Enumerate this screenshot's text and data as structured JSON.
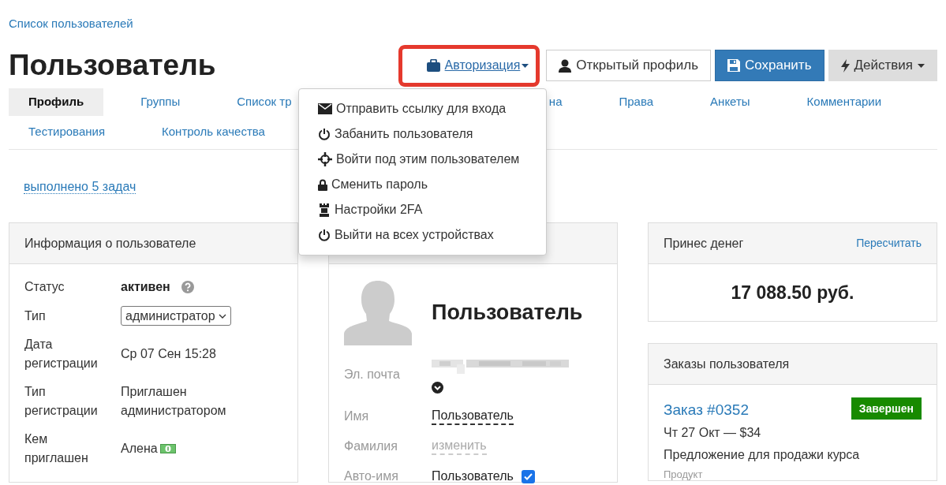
{
  "breadcrumb": "Список пользователей",
  "title": "Пользователь",
  "toolbar": {
    "auth": {
      "label": "Авторизация",
      "expanded": true
    },
    "buttons": [
      {
        "label": "Открытый профиль",
        "kind": "profile"
      },
      {
        "label": "Сохранить",
        "kind": "save"
      },
      {
        "label": "Действия",
        "kind": "actions"
      }
    ]
  },
  "auth_menu": [
    {
      "label": "Отправить ссылку для входа",
      "kind": "send"
    },
    {
      "label": "Забанить пользователя",
      "kind": "ban"
    },
    {
      "label": "Войти под этим пользователем",
      "kind": "impersonate"
    },
    {
      "label": "Сменить пароль",
      "kind": "password"
    },
    {
      "label": "Настройки 2FA",
      "kind": "twofa"
    },
    {
      "label": "Выйти на всех устройствах",
      "kind": "logout"
    }
  ],
  "tabs": [
    [
      {
        "label": "Профиль",
        "selected": true
      },
      {
        "label": "Группы",
        "selected": false
      },
      {
        "label": "Список тр",
        "selected": false,
        "kind": "cut_right"
      },
      {
        "label": "на",
        "selected": false,
        "kind": "cut_left"
      },
      {
        "label": "Права",
        "selected": false
      },
      {
        "label": "Анкеты",
        "selected": false
      },
      {
        "label": "Комментарии",
        "selected": false
      }
    ],
    [
      {
        "label": "Тестирования",
        "selected": false
      },
      {
        "label": "Контроль качества",
        "selected": false
      }
    ]
  ],
  "tasks_link": "выполнено 5 задач",
  "user_info": {
    "title": "Информация о пользователе",
    "rows": [
      {
        "label": "Статус",
        "value": "активен",
        "kind": "status"
      },
      {
        "label": "Тип",
        "value": "администратор",
        "kind": "select"
      },
      {
        "label": "Дата регистрации",
        "value": "Ср 07 Сен 15:28",
        "kind": "text"
      },
      {
        "label": "Тип регистрации",
        "value": "Приглашен администратором",
        "kind": "text"
      },
      {
        "label": "Кем приглашен",
        "value": "Алена",
        "kind": "person"
      }
    ]
  },
  "profile": {
    "name": "Пользователь",
    "fields": [
      {
        "label": "Эл. почта",
        "kind": "email"
      },
      {
        "label": "Имя",
        "value": "Пользователь",
        "kind": "editable"
      },
      {
        "label": "Фамилия",
        "value": "изменить",
        "kind": "empty"
      },
      {
        "label": "Авто-имя",
        "value": "Пользователь",
        "kind": "check",
        "checked": true
      }
    ]
  },
  "money": {
    "title": "Принес денег",
    "action": "Пересчитать",
    "amount": "17 088.50 руб."
  },
  "orders": {
    "title": "Заказы пользователя",
    "items": [
      {
        "link": "Заказ #0352",
        "status": "Завершен",
        "color": "#188a00",
        "date": "Чт 27 Окт — $34",
        "offer": "Предложение для продажи курса",
        "type": "Продукт"
      }
    ]
  }
}
